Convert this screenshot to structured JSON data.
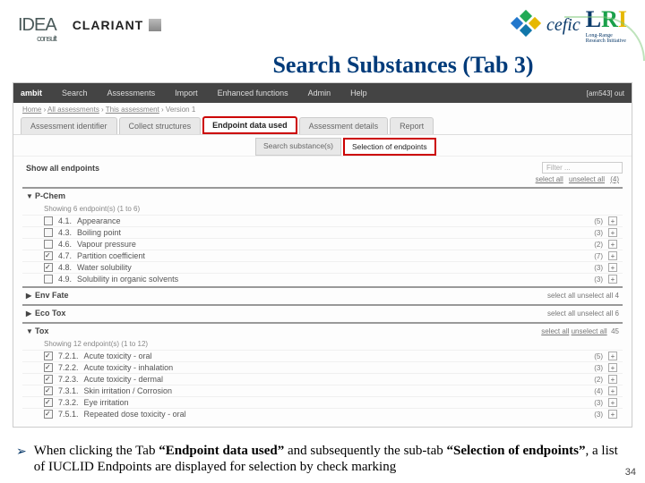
{
  "logos": {
    "idea": "IDEA",
    "idea_sub": "consult",
    "clariant": "CLARIANT",
    "cefic": "cefic",
    "lri": {
      "l": "L",
      "r": "R",
      "i": "I",
      "sub1": "Long-Range",
      "sub2": "Research Initiative"
    }
  },
  "slide_title_main": "Search Substances",
  "slide_title_paren": "(Tab 3)",
  "app": {
    "brand": "ambit",
    "menus": [
      "Search",
      "Assessments",
      "Import",
      "Enhanced functions",
      "Admin",
      "Help"
    ],
    "user_label": "[am543]  out",
    "breadcrumb": [
      "Home",
      "All assessments",
      "This assessment",
      "Version 1"
    ],
    "tabs": [
      "Assessment identifier",
      "Collect structures",
      "Endpoint data used",
      "Assessment details",
      "Report"
    ],
    "active_tab_index": 2,
    "subtabs": [
      "Search substance(s)",
      "Selection of endpoints"
    ],
    "active_subtab_index": 1,
    "show_all_label": "Show all endpoints",
    "filter_placeholder": "Filter ...",
    "select_links": {
      "all": "select all",
      "none": "unselect all",
      "count": "(4)"
    },
    "sections": [
      {
        "name": "P-Chem",
        "expanded": true,
        "subhead": "Showing 6 endpoint(s) (1 to 6)",
        "rows": [
          {
            "code": "4.1.",
            "label": "Appearance",
            "checked": false,
            "count": "(5)"
          },
          {
            "code": "4.3.",
            "label": "Boiling point",
            "checked": false,
            "count": "(3)"
          },
          {
            "code": "4.6.",
            "label": "Vapour pressure",
            "checked": false,
            "count": "(2)"
          },
          {
            "code": "4.7.",
            "label": "Partition coefficient",
            "checked": true,
            "count": "(7)"
          },
          {
            "code": "4.8.",
            "label": "Water solubility",
            "checked": true,
            "count": "(3)"
          },
          {
            "code": "4.9.",
            "label": "Solubility in organic solvents",
            "checked": false,
            "count": "(3)"
          }
        ]
      },
      {
        "name": "Env Fate",
        "expanded": false,
        "right": "select all unselect all   4"
      },
      {
        "name": "Eco Tox",
        "expanded": false,
        "right": "select all unselect all   6"
      },
      {
        "name": "Tox",
        "expanded": true,
        "subhead": "Showing 12 endpoint(s) (1 to 12)",
        "right_count": "45",
        "rows": [
          {
            "code": "7.2.1.",
            "label": "Acute toxicity - oral",
            "checked": true,
            "count": "(5)"
          },
          {
            "code": "7.2.2.",
            "label": "Acute toxicity - inhalation",
            "checked": true,
            "count": "(3)"
          },
          {
            "code": "7.2.3.",
            "label": "Acute toxicity - dermal",
            "checked": true,
            "count": "(2)"
          },
          {
            "code": "7.3.1.",
            "label": "Skin irritation / Corrosion",
            "checked": true,
            "count": "(4)"
          },
          {
            "code": "7.3.2.",
            "label": "Eye irritation",
            "checked": true,
            "count": "(3)"
          },
          {
            "code": "7.5.1.",
            "label": "Repeated dose toxicity - oral",
            "checked": true,
            "count": "(3)"
          }
        ]
      }
    ]
  },
  "bullet_text": {
    "pre": "When clicking the Tab ",
    "b1": "“Endpoint data used”",
    "mid": " and subsequently the sub-tab ",
    "b2": "“Selection of endpoints”",
    "post": ", a list of IUCLID Endpoints are displayed for selection by check marking"
  },
  "page_number": "34"
}
